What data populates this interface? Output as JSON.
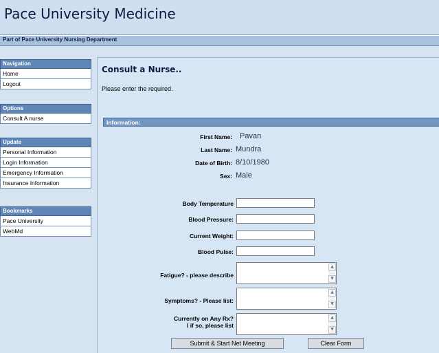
{
  "site": {
    "title": "Pace University Medicine",
    "subtitle": "Part of Pace University Nursing Department"
  },
  "sidebar": {
    "navigation": {
      "heading": "Navigation",
      "items": [
        "Home",
        "Logout"
      ]
    },
    "options": {
      "heading": "Options",
      "items": [
        "Consult A nurse"
      ]
    },
    "update": {
      "heading": "Update",
      "items": [
        "Personal Information",
        "Login Information",
        "Emergency Information",
        "Insurance Information"
      ]
    },
    "bookmarks": {
      "heading": "Bookmarks",
      "items": [
        "Pace University",
        "WebMd"
      ]
    }
  },
  "main": {
    "title": "Consult a Nurse..",
    "intro": "Please enter the required.",
    "section_heading": "Information:",
    "patient": {
      "first_name_label": "First Name:",
      "first_name": "Pavan",
      "last_name_label": "Last Name:",
      "last_name": "Mundra",
      "dob_label": "Date of Birth:",
      "dob": "8/10/1980",
      "sex_label": "Sex:",
      "sex": "Male"
    },
    "form": {
      "body_temp_label": "Body Temperature",
      "blood_pressure_label": "Blood Pressure:",
      "weight_label": "Current Weight:",
      "pulse_label": "Blood Pulse:",
      "fatigue_label": "Fatigue? - please describe",
      "symptoms_label": "Symptoms? - Please list:",
      "rx_label_line1": "Currently on Any Rx?",
      "rx_label_line2": "I if so, please list"
    },
    "buttons": {
      "submit": "Submit & Start Net Meeting",
      "clear": "Clear Form"
    }
  }
}
